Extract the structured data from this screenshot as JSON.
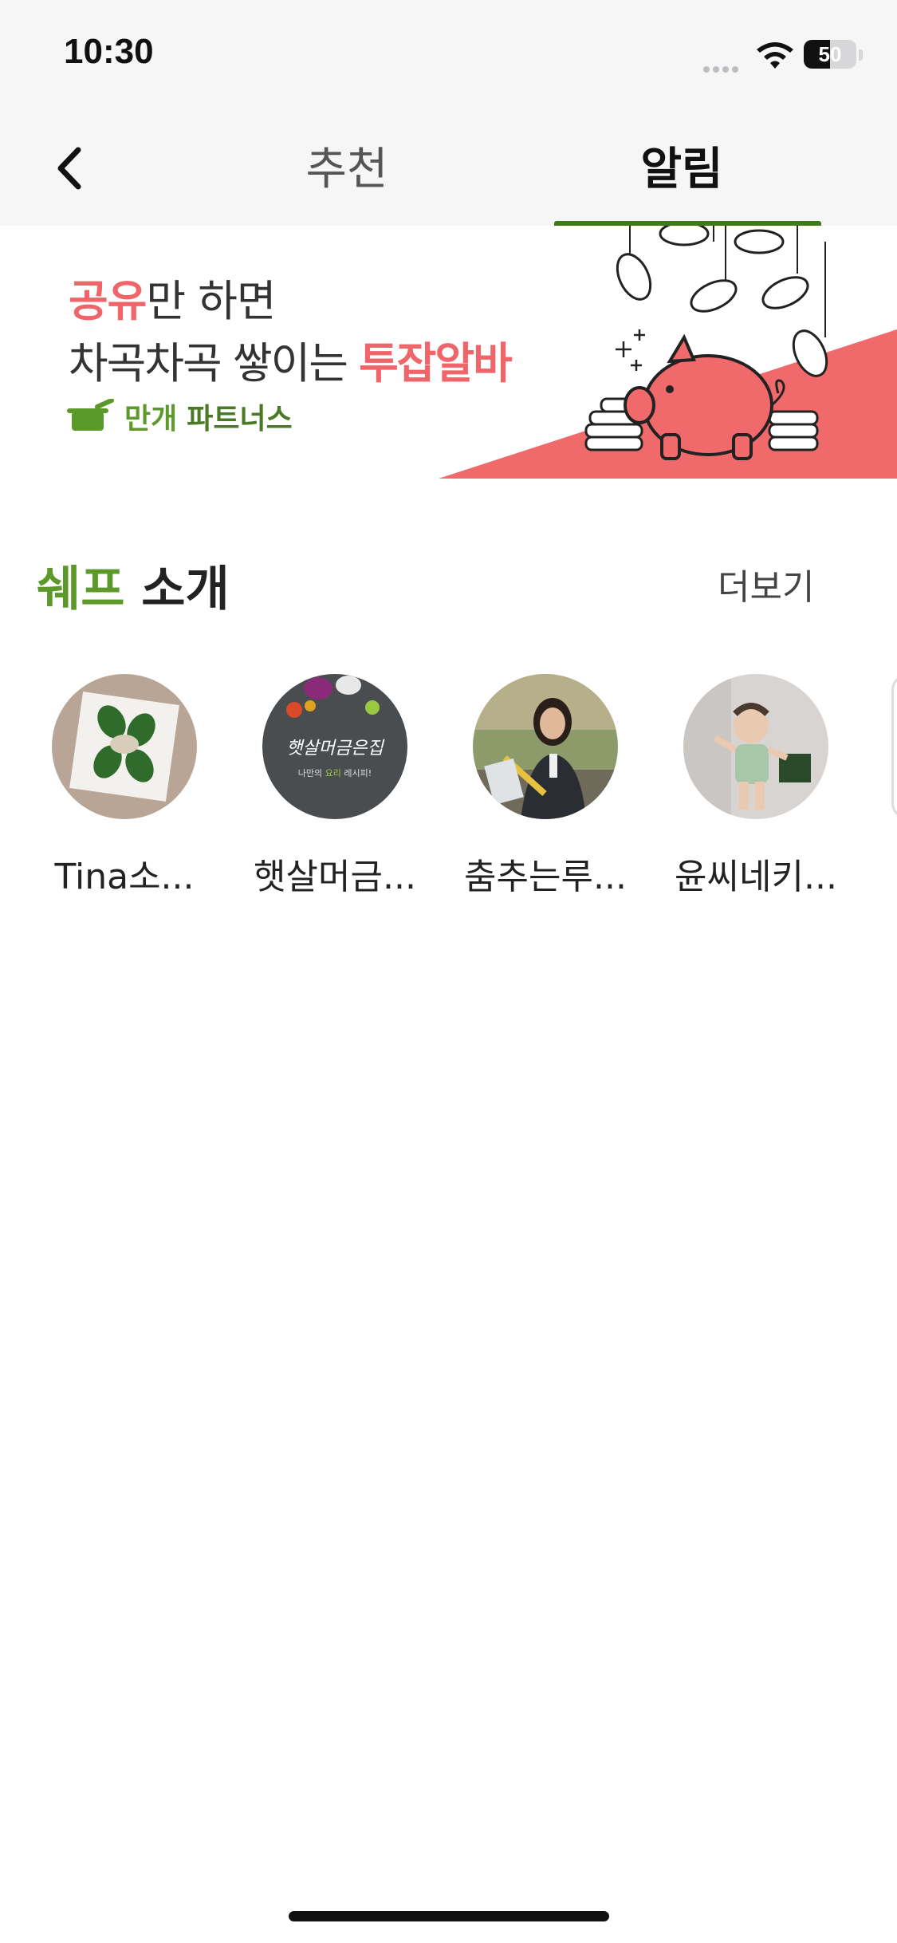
{
  "status_bar": {
    "time": "10:30",
    "battery": "50",
    "battery_level": 0.5
  },
  "nav": {
    "back_icon": "chevron-left-icon",
    "tabs": [
      {
        "label": "추천",
        "active": false
      },
      {
        "label": "알림",
        "active": true
      }
    ]
  },
  "banner": {
    "line1_highlight": "공유",
    "line1_rest": "만 하면",
    "line2_rest": "차곡차곡 쌓이는 ",
    "line2_highlight": "투잡알바",
    "brand": "만개",
    "brand_suffix": "파트너스",
    "colors": {
      "highlight": "#f06569",
      "brand_green": "#5b9a2a"
    }
  },
  "chef_section": {
    "title_accent": "쉐프",
    "title_rest": " 소개",
    "more_label": "더보기",
    "chefs": [
      {
        "name": "Tina소..."
      },
      {
        "name": "햇살머금..."
      },
      {
        "name": "춤추는루..."
      },
      {
        "name": "윤씨네키..."
      }
    ]
  },
  "avatar_2_caption": {
    "title": "햇살머금은집",
    "subtitle_a": "나만의",
    "subtitle_b": "요리",
    "subtitle_c": "레시피!"
  }
}
